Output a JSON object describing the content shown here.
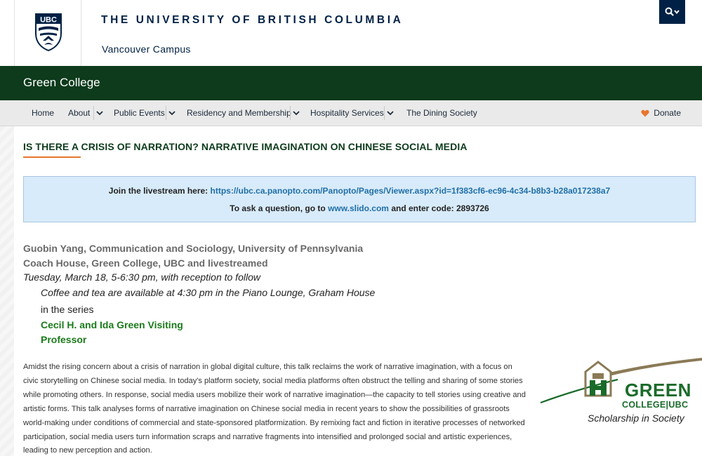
{
  "ubc": {
    "crest_text": "UBC",
    "wordmark": "THE UNIVERSITY OF BRITISH COLUMBIA",
    "campus": "Vancouver Campus"
  },
  "unit": {
    "name": "Green College"
  },
  "nav": {
    "items": [
      {
        "label": "Home",
        "has_dropdown": false
      },
      {
        "label": "About",
        "has_dropdown": true
      },
      {
        "label": "Public Events",
        "has_dropdown": true
      },
      {
        "label": "Residency and Membership",
        "has_dropdown": true
      },
      {
        "label": "Hospitality Services",
        "has_dropdown": true
      },
      {
        "label": "The Dining Society",
        "has_dropdown": false
      }
    ],
    "donate_label": "Donate"
  },
  "event": {
    "title": "IS THERE A CRISIS OF NARRATION? NARRATIVE IMAGINATION ON CHINESE SOCIAL MEDIA",
    "livestream_prefix": "Join the livestream here: ",
    "livestream_url": "https://ubc.ca.panopto.com/Panopto/Pages/Viewer.aspx?id=1f383cf6-ec96-4c34-b8b3-b28a017238a7",
    "question_prefix": "To ask a question, go to ",
    "question_link": "www.slido.com",
    "question_suffix": " and enter code: 2893726",
    "speaker": "Guobin Yang, Communication and Sociology, University of Pennsylvania",
    "venue": "Coach House, Green College, UBC and livestreamed",
    "datetime": "Tuesday, March 18, 5-6:30 pm, with reception to follow",
    "coffee_note": "Coffee and tea are available at 4:30 pm in the Piano Lounge, Graham House",
    "series_label": "in the series",
    "series_name": "Cecil H. and Ida Green Visiting Professor",
    "abstract": "Amidst the rising concern about a crisis of narration in global digital culture, this talk reclaims the work of narrative imagination, with a focus on civic storytelling on Chinese social media. In today's platform society, social media platforms often obstruct the telling and sharing of some stories while promoting others. In response, social media users mobilize their work of narrative imagination—the capacity to tell stories using creative and artistic forms. This talk analyses forms of narrative imagination on Chinese social media in recent years to show the possibilities of grassroots world-making under conditions of commercial and state-sponsored platformization. By remixing fact and fiction in iterative processes of networked participation, social media users turn information scraps and narrative fragments into intensified and prolonged social and artistic experiences, leading to new perception and action."
  },
  "gc_logo": {
    "word1": "GREEN",
    "word2": "COLLEGE|UBC",
    "tagline": "Scholarship in Society"
  },
  "icons": {
    "search": "search-icon",
    "caret": "chevron-down-icon",
    "heart": "heart-icon"
  },
  "colors": {
    "ubc_navy": "#002145",
    "gc_green": "#0d3b1c",
    "accent_orange": "#e8762d",
    "link_blue": "#1f6fa8",
    "series_green": "#1a7a1a"
  }
}
